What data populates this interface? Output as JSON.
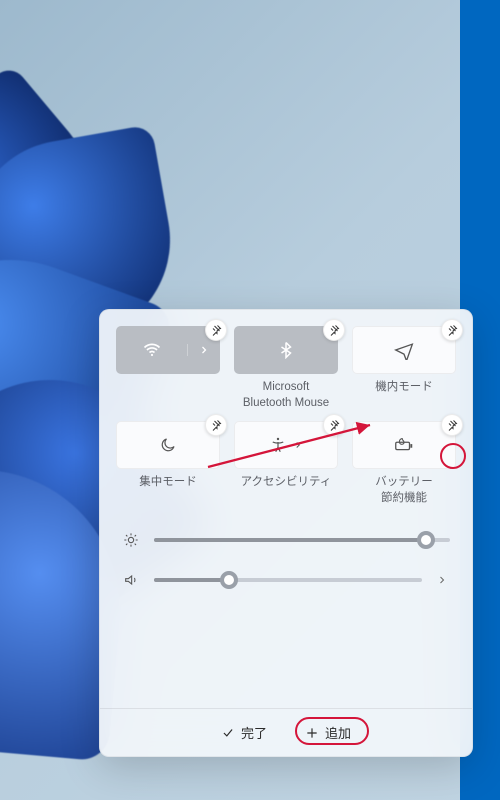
{
  "tiles": [
    {
      "name": "wifi",
      "label": "",
      "active": true,
      "split": true,
      "icon": "wifi"
    },
    {
      "name": "bluetooth",
      "label": "Microsoft\nBluetooth Mouse",
      "active": true,
      "split": false,
      "icon": "bluetooth"
    },
    {
      "name": "airplane",
      "label": "機内モード",
      "active": false,
      "split": false,
      "icon": "airplane"
    },
    {
      "name": "focus",
      "label": "集中モード",
      "active": false,
      "split": false,
      "icon": "moon"
    },
    {
      "name": "accessibility",
      "label": "アクセシビリティ",
      "active": false,
      "split": true,
      "icon": "accessibility"
    },
    {
      "name": "battery-saver",
      "label": "バッテリー\n節約機能",
      "active": false,
      "split": false,
      "icon": "battery"
    }
  ],
  "sliders": {
    "brightness": 92,
    "volume": 28
  },
  "footer": {
    "done": "完了",
    "add": "追加"
  }
}
